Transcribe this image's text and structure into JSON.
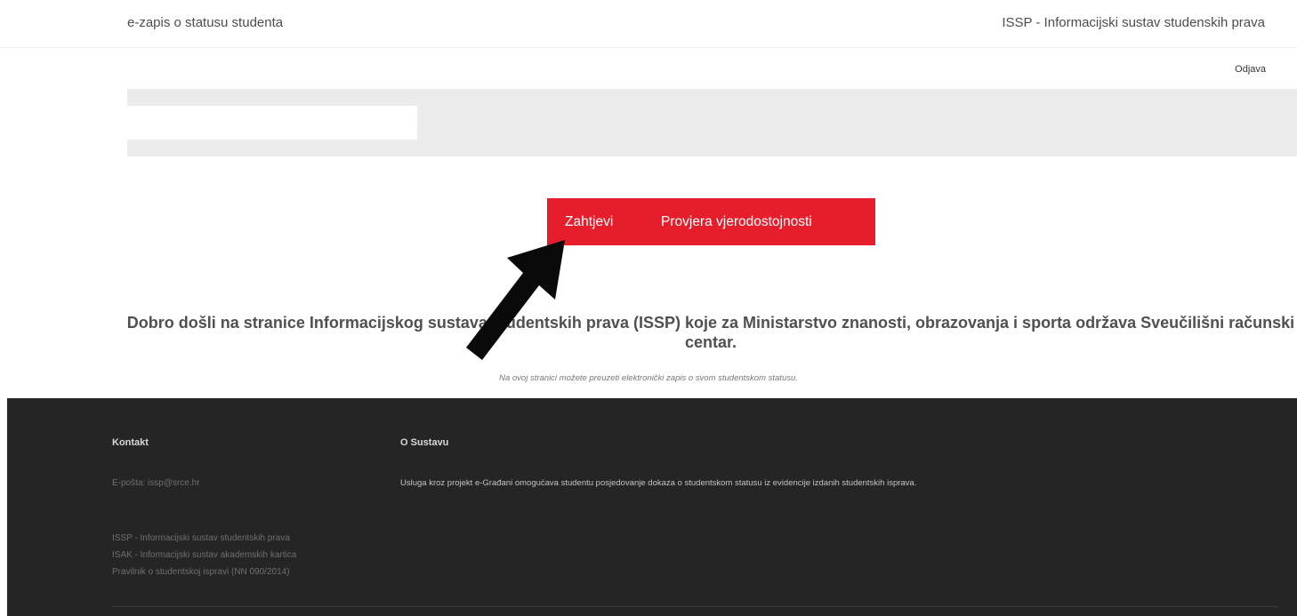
{
  "header": {
    "app_title": "e-zapis o statusu studenta",
    "system_title": "ISSP - Informacijski sustav studenskih prava"
  },
  "user_menu": {
    "logout_label": "Odjava"
  },
  "nav": {
    "items": [
      {
        "label": "Zahtjevi"
      },
      {
        "label": "Provjera vjerodostojnosti"
      }
    ],
    "background_color": "#e61e2b"
  },
  "annotation": {
    "icon": "arrow-pointer-icon",
    "points_to": "Zahtjevi"
  },
  "welcome": {
    "heading": "Dobro došli na stranice Informacijskog sustava studentskih prava (ISSP) koje za Ministarstvo znanosti, obrazovanja i sporta održava Sveučilišni računski centar.",
    "subtext": "Na ovoj stranici možete preuzeti elektronički zapis o svom studentskom statusu."
  },
  "footer": {
    "contact": {
      "heading": "Kontakt",
      "email_label": "E-pošta:",
      "email": "issp@srce.hr"
    },
    "about": {
      "heading": "O Sustavu",
      "text": "Usluga kroz projekt e-Građani omogućava studentu posjedovanje dokaza o studentskom statusu iz evidencije izdanih studentskih isprava."
    },
    "links": [
      {
        "label": "ISSP - Informacijski sustav studentskih prava"
      },
      {
        "label": "ISAK - Informacijski sustav akademskih kartica"
      },
      {
        "label": "Pravilnik o studentskoj ispravi (NN 090/2014)"
      }
    ],
    "background_color": "#252525"
  }
}
